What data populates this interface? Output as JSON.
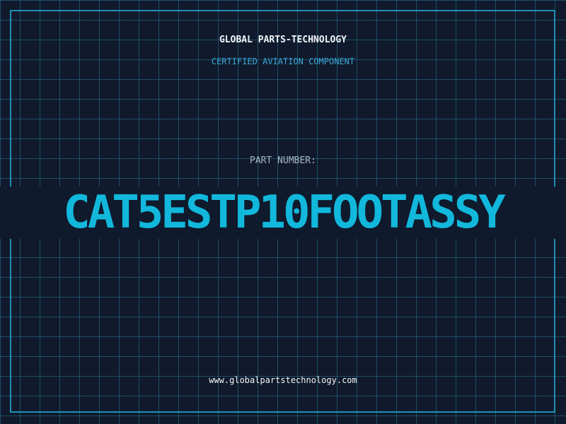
{
  "header": {
    "company": "GLOBAL PARTS-TECHNOLOGY",
    "subtitle": "CERTIFIED AVIATION COMPONENT"
  },
  "part": {
    "label": "PART NUMBER:",
    "number": "CAT5ESTP10FOOTASSY"
  },
  "footer": {
    "url": "www.globalpartstechnology.com"
  },
  "colors": {
    "background": "#101a2c",
    "grid": "#28789a",
    "frame": "#1f8fb4",
    "accent": "#12b8dc"
  }
}
